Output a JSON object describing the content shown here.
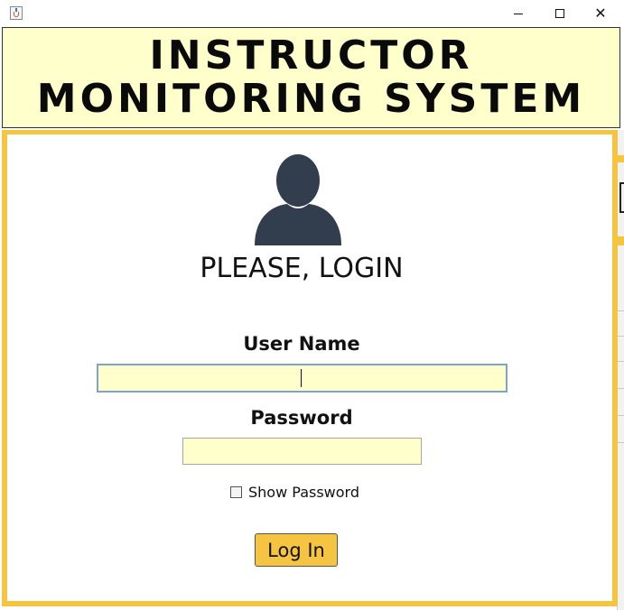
{
  "window": {
    "icon": "java-cup-icon",
    "controls": [
      "minimize-icon",
      "maximize-icon",
      "close-icon"
    ],
    "close_glyph": "✕"
  },
  "header": {
    "title": "INSTRUCTOR MONITORING SYSTEM"
  },
  "login": {
    "avatar_icon": "user-icon",
    "heading": "PLEASE, LOGIN",
    "username_label": "User Name",
    "username_value": "",
    "password_label": "Password",
    "password_value": "",
    "show_password_label": "Show Password",
    "show_password_checked": false,
    "button_label": "Log In"
  },
  "colors": {
    "accent": "#f5c542",
    "field_background": "#ffffcc",
    "header_background": "#ffffcc",
    "avatar": "#323e4e"
  }
}
